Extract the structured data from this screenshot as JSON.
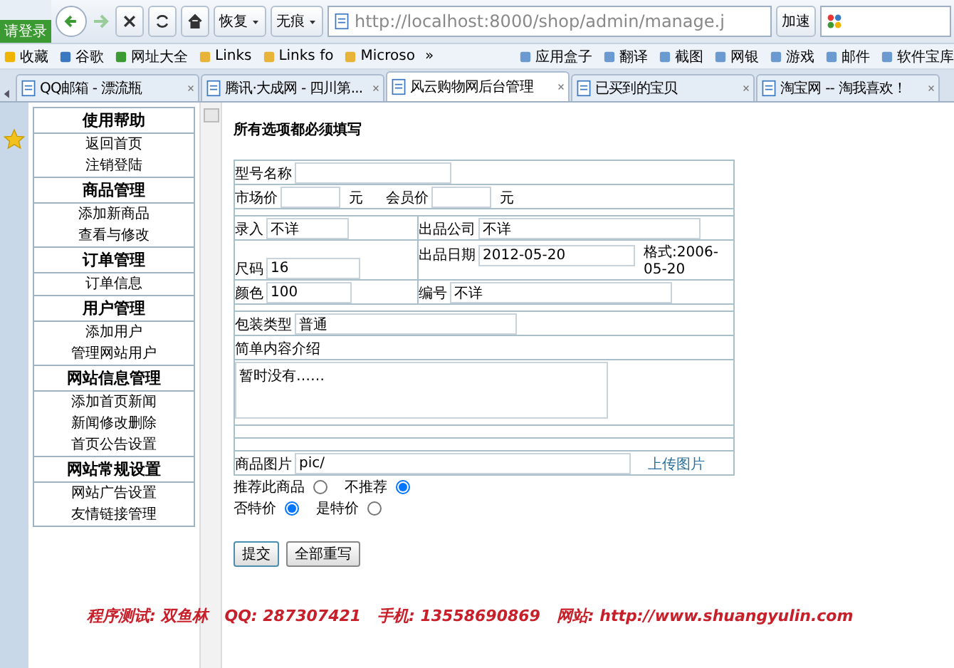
{
  "toolbar": {
    "login": "请登录",
    "restore": "恢复",
    "no_trace": "无痕",
    "address": "http://localhost:8000/shop/admin/manage.j",
    "accelerate": "加速"
  },
  "bookmarks": [
    "收藏",
    "谷歌",
    "网址大全",
    "Links",
    "Links fo",
    "Microso",
    "»"
  ],
  "addons": [
    "应用盒子",
    "翻译",
    "截图",
    "网银",
    "游戏",
    "邮件",
    "软件宝库"
  ],
  "tabs": [
    {
      "label": "QQ邮箱 - 漂流瓶",
      "selected": false
    },
    {
      "label": "腾讯·大成网 - 四川第...",
      "selected": false
    },
    {
      "label": "风云购物网后台管理",
      "selected": true
    },
    {
      "label": "已买到的宝贝",
      "selected": false
    },
    {
      "label": "淘宝网 -- 淘我喜欢！",
      "selected": false
    }
  ],
  "sidebar": [
    {
      "title": "使用帮助",
      "items": [
        "返回首页",
        "注销登陆"
      ]
    },
    {
      "title": "商品管理",
      "items": [
        "添加新商品",
        "查看与修改"
      ]
    },
    {
      "title": "订单管理",
      "items": [
        "订单信息"
      ]
    },
    {
      "title": "用户管理",
      "items": [
        "添加用户",
        "管理网站用户"
      ]
    },
    {
      "title": "网站信息管理",
      "items": [
        "添加首页新闻",
        "新闻修改删除",
        "首页公告设置"
      ]
    },
    {
      "title": "网站常规设置",
      "items": [
        "网站广告设置",
        "友情链接管理"
      ]
    }
  ],
  "form": {
    "heading": "所有选项都必须填写",
    "model_name": {
      "label": "型号名称"
    },
    "market_price": {
      "label": "市场价",
      "unit": "元"
    },
    "member_price": {
      "label": "会员价",
      "unit": "元"
    },
    "left_fields": [
      {
        "label": "录入",
        "value": "不详"
      },
      {
        "label": "尺码",
        "value": "16"
      },
      {
        "label": "颜色",
        "value": "100"
      }
    ],
    "company": {
      "label": "出品公司",
      "value": "不详"
    },
    "date": {
      "label": "出品日期",
      "value": "2012-05-20",
      "hint": "格式:2006-05-20"
    },
    "number": {
      "label": "编号",
      "value": "不详"
    },
    "package": {
      "label": "包装类型",
      "value": "普通"
    },
    "intro": {
      "label": "简单内容介绍",
      "value": "暂时没有……"
    },
    "image": {
      "label": "商品图片",
      "value": "pic/",
      "link": "上传图片"
    },
    "recommend": [
      {
        "label": "推荐此商品",
        "selected": false
      },
      {
        "label": "不推荐",
        "selected": true
      }
    ],
    "special": [
      {
        "label": "否特价",
        "selected": true
      },
      {
        "label": "是特价",
        "selected": false
      }
    ],
    "buttons": [
      "提交",
      "全部重写"
    ]
  },
  "footer": "程序测试: 双鱼林   QQ: 287307421   手机: 13558690869   网站: http://www.shuangyulin.com"
}
